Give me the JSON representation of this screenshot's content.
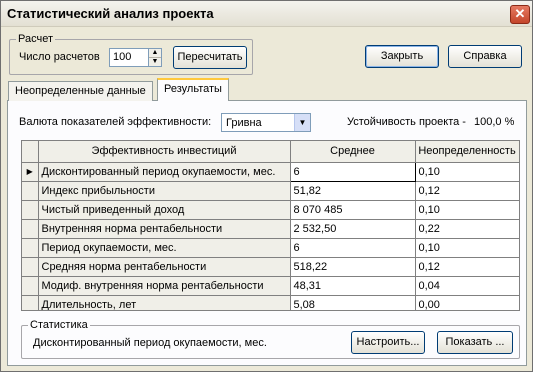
{
  "window": {
    "title": "Статистический анализ проекта",
    "close_glyph": "✕"
  },
  "calc": {
    "legend": "Расчет",
    "count_label": "Число расчетов",
    "count_value": "100",
    "recalc_button": "Пересчитать"
  },
  "buttons": {
    "close": "Закрыть",
    "help": "Справка"
  },
  "tabs": [
    {
      "label": "Неопределенные данные",
      "active": false
    },
    {
      "label": "Результаты",
      "active": true
    }
  ],
  "results": {
    "currency_label": "Валюта показателей эффективности:",
    "currency_value": "Гривна",
    "stability_label": "Устойчивость проекта -",
    "stability_value": "100,0 %"
  },
  "table": {
    "headers": [
      "Эффективность инвестиций",
      "Среднее",
      "Неопределенность"
    ],
    "rows": [
      {
        "name": "Дисконтированный период окупаемости, мес.",
        "mean": "6",
        "uncertainty": "0,10",
        "current": true
      },
      {
        "name": "Индекс прибыльности",
        "mean": "51,82",
        "uncertainty": "0,12",
        "current": false
      },
      {
        "name": "Чистый приведенный доход",
        "mean": "8 070 485",
        "uncertainty": "0,10",
        "current": false
      },
      {
        "name": "Внутренняя норма рентабельности",
        "mean": "2 532,50",
        "uncertainty": "0,22",
        "current": false
      },
      {
        "name": "Период окупаемости, мес.",
        "mean": "6",
        "uncertainty": "0,10",
        "current": false
      },
      {
        "name": "Средняя норма рентабельности",
        "mean": "518,22",
        "uncertainty": "0,12",
        "current": false
      },
      {
        "name": "Модиф. внутренняя норма рентабельности",
        "mean": "48,31",
        "uncertainty": "0,04",
        "current": false
      },
      {
        "name": "Длительность, лет",
        "mean": "5,08",
        "uncertainty": "0,00",
        "current": false
      }
    ]
  },
  "stats": {
    "legend": "Статистика",
    "selected_text": "Дисконтированный период окупаемости, мес.",
    "configure_button": "Настроить...",
    "show_button": "Показать ..."
  }
}
